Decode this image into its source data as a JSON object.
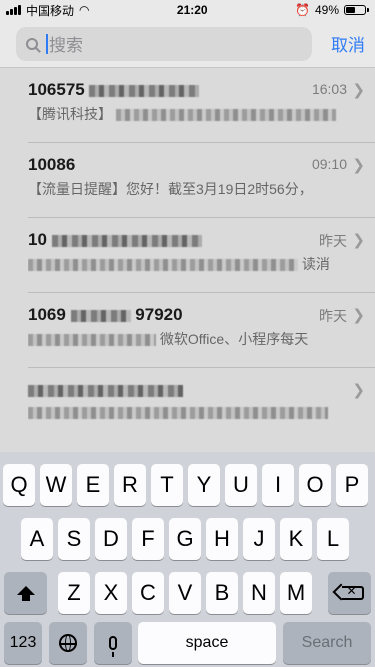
{
  "status_bar": {
    "carrier": "中国移动",
    "time": "21:20",
    "battery_percent": "49%",
    "battery_level": 0.49
  },
  "search": {
    "placeholder": "搜索",
    "cancel_label": "取消"
  },
  "messages": [
    {
      "sender": "106575",
      "time": "16:03",
      "preview": "【腾讯科技】"
    },
    {
      "sender": "10086",
      "time": "09:10",
      "preview": "【流量日提醒】您好！截至3月19日2时56分，"
    },
    {
      "sender": "10",
      "time": "昨天",
      "preview": "读消"
    },
    {
      "sender": "1069",
      "sender_suffix": "97920",
      "time": "昨天",
      "preview": "微软Office、小程序每天"
    },
    {
      "sender": "",
      "time": "",
      "preview": ""
    }
  ],
  "keyboard": {
    "row1": [
      "Q",
      "W",
      "E",
      "R",
      "T",
      "Y",
      "U",
      "I",
      "O",
      "P"
    ],
    "row2": [
      "A",
      "S",
      "D",
      "F",
      "G",
      "H",
      "J",
      "K",
      "L"
    ],
    "row3": [
      "Z",
      "X",
      "C",
      "V",
      "B",
      "N",
      "M"
    ],
    "numbers_label": "123",
    "space_label": "space",
    "search_label": "Search"
  }
}
